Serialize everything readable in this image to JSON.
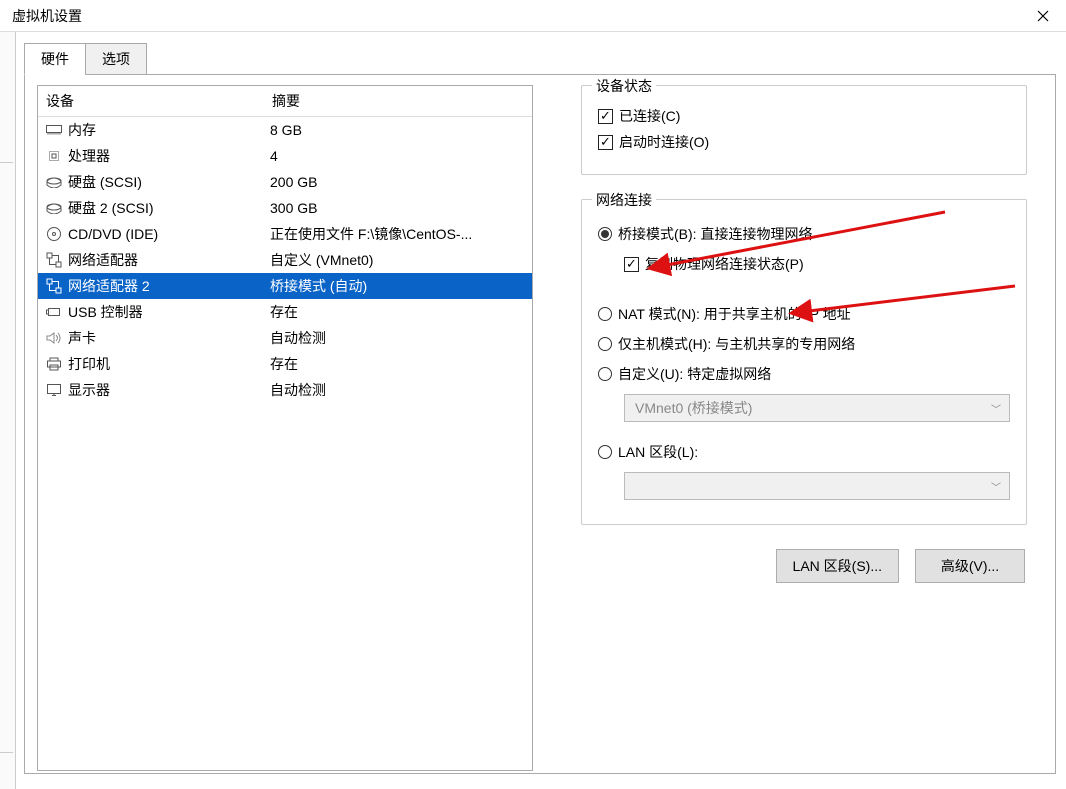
{
  "window": {
    "title": "虚拟机设置"
  },
  "tabs": {
    "hardware": "硬件",
    "options": "选项"
  },
  "device_table": {
    "col_device": "设备",
    "col_summary": "摘要",
    "rows": [
      {
        "icon": "memory",
        "name": "内存",
        "summary": "8 GB",
        "selected": false
      },
      {
        "icon": "cpu",
        "name": "处理器",
        "summary": "4",
        "selected": false
      },
      {
        "icon": "disk",
        "name": "硬盘 (SCSI)",
        "summary": "200 GB",
        "selected": false
      },
      {
        "icon": "disk",
        "name": "硬盘 2 (SCSI)",
        "summary": "300 GB",
        "selected": false
      },
      {
        "icon": "cd",
        "name": "CD/DVD (IDE)",
        "summary": "正在使用文件 F:\\镜像\\CentOS-...",
        "selected": false
      },
      {
        "icon": "net",
        "name": "网络适配器",
        "summary": "自定义 (VMnet0)",
        "selected": false
      },
      {
        "icon": "net",
        "name": "网络适配器 2",
        "summary": "桥接模式 (自动)",
        "selected": true
      },
      {
        "icon": "usb",
        "name": "USB 控制器",
        "summary": "存在",
        "selected": false
      },
      {
        "icon": "sound",
        "name": "声卡",
        "summary": "自动检测",
        "selected": false
      },
      {
        "icon": "printer",
        "name": "打印机",
        "summary": "存在",
        "selected": false
      },
      {
        "icon": "display",
        "name": "显示器",
        "summary": "自动检测",
        "selected": false
      }
    ]
  },
  "device_status": {
    "legend": "设备状态",
    "connected": "已连接(C)",
    "connect_at_power_on": "启动时连接(O)"
  },
  "network": {
    "legend": "网络连接",
    "bridged": "桥接模式(B): 直接连接物理网络",
    "replicate": "复制物理网络连接状态(P)",
    "nat": "NAT 模式(N): 用于共享主机的 IP 地址",
    "hostonly": "仅主机模式(H): 与主机共享的专用网络",
    "custom": "自定义(U): 特定虚拟网络",
    "custom_value": "VMnet0 (桥接模式)",
    "lan_segment": "LAN 区段(L):",
    "lan_segment_value": ""
  },
  "buttons": {
    "lan_segments": "LAN 区段(S)...",
    "advanced": "高级(V)..."
  }
}
